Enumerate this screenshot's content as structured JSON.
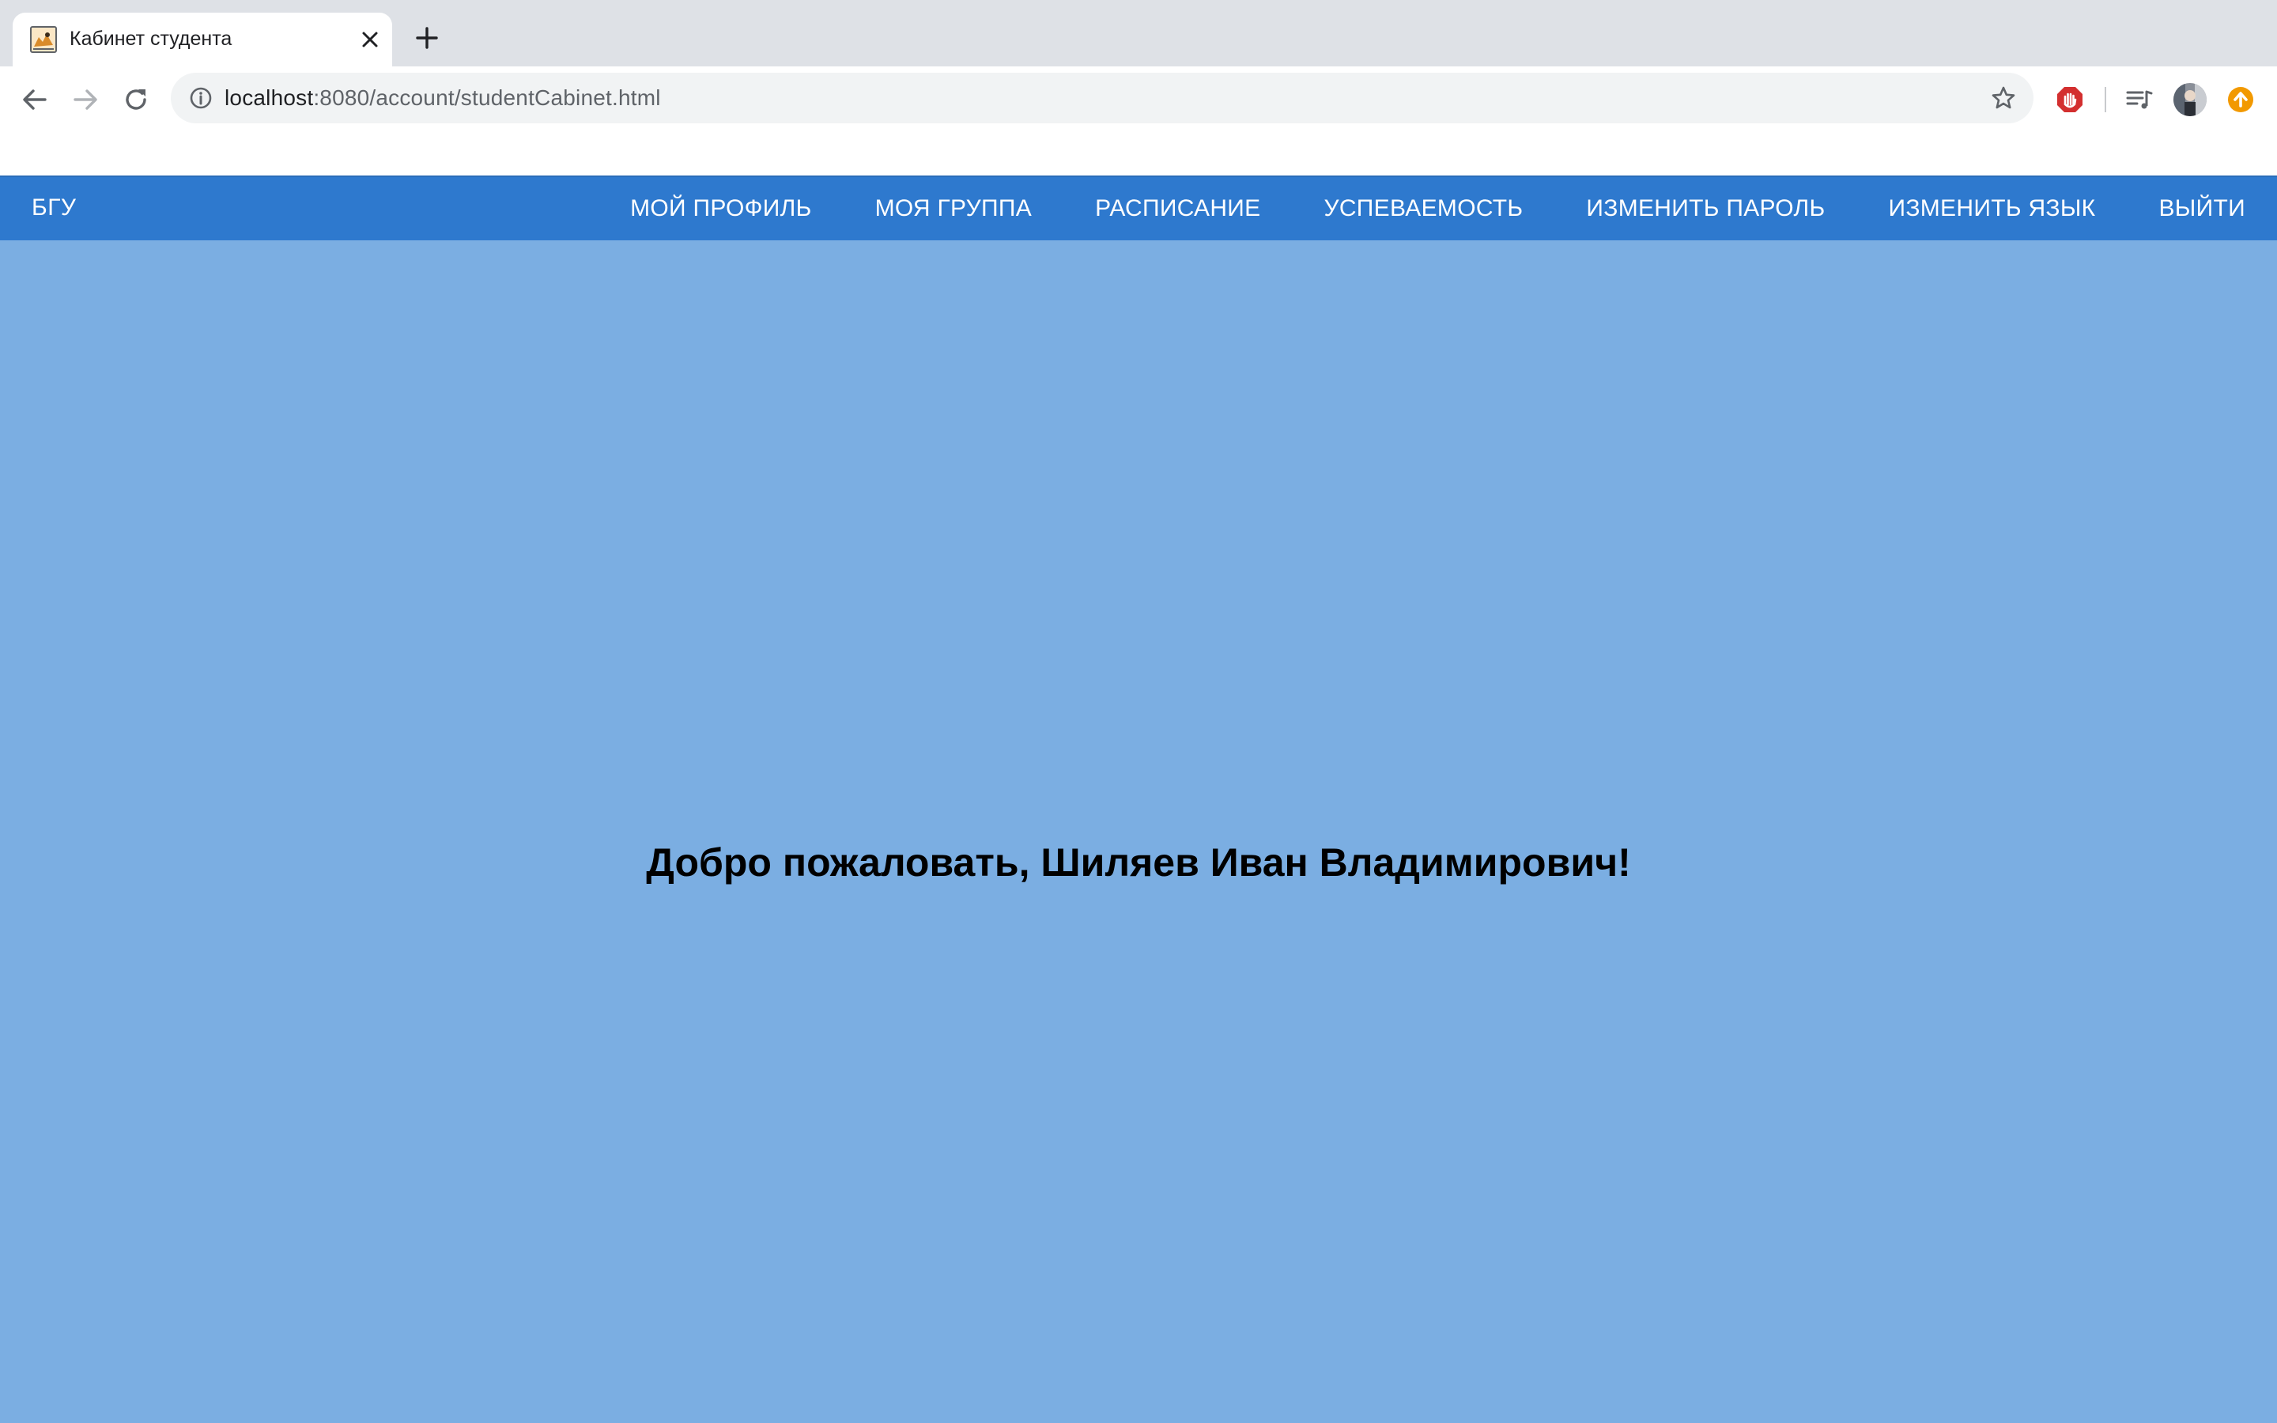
{
  "browser": {
    "tab": {
      "title": "Кабинет студента",
      "favicon": "cat-favicon",
      "close_icon": "close-icon"
    },
    "new_tab_icon": "plus-icon",
    "toolbar": {
      "back_icon": "arrow-left-icon",
      "forward_icon": "arrow-right-icon",
      "reload_icon": "reload-icon"
    },
    "address_bar": {
      "host": "localhost",
      "path": ":8080/account/studentCabinet.html",
      "info_icon": "info-icon",
      "star_icon": "star-icon"
    },
    "extensions": [
      "adblock-icon",
      "media-queue-icon",
      "profile-avatar-icon",
      "update-icon"
    ]
  },
  "navbar": {
    "brand": "БГУ",
    "color": "#2e79ce",
    "items": [
      {
        "label": "МОЙ ПРОФИЛЬ"
      },
      {
        "label": "МОЯ ГРУППА"
      },
      {
        "label": "РАСПИСАНИЕ"
      },
      {
        "label": "УСПЕВАЕМОСТЬ"
      },
      {
        "label": "ИЗМЕНИТЬ ПАРОЛЬ"
      },
      {
        "label": "ИЗМЕНИТЬ ЯЗЫК"
      },
      {
        "label": "ВЫЙТИ"
      }
    ]
  },
  "main": {
    "background": "#7baee2",
    "welcome": "Добро пожаловать, Шиляев Иван Владимирович!"
  }
}
